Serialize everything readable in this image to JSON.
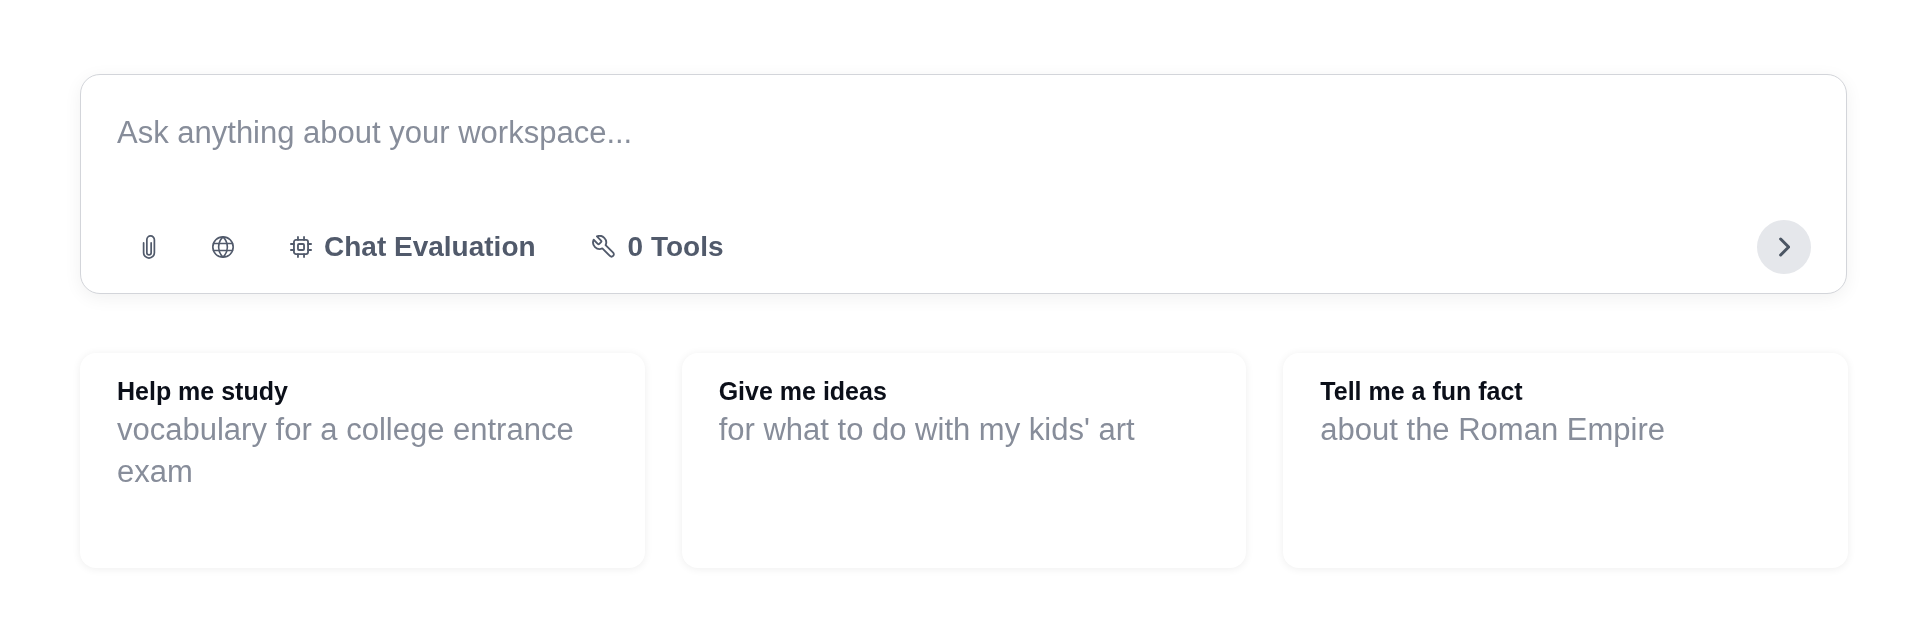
{
  "composer": {
    "placeholder": "Ask anything about your workspace...",
    "tools": [
      {
        "kind": "attach"
      },
      {
        "kind": "web"
      },
      {
        "kind": "model",
        "label": "Chat Evaluation"
      },
      {
        "kind": "tools",
        "label": "0 Tools"
      }
    ]
  },
  "suggestions": [
    {
      "title": "Help me study",
      "subtitle": "vocabulary for a college entrance exam"
    },
    {
      "title": "Give me ideas",
      "subtitle": "for what to do with my kids' art"
    },
    {
      "title": "Tell me a fun fact",
      "subtitle": "about the Roman Empire"
    }
  ]
}
